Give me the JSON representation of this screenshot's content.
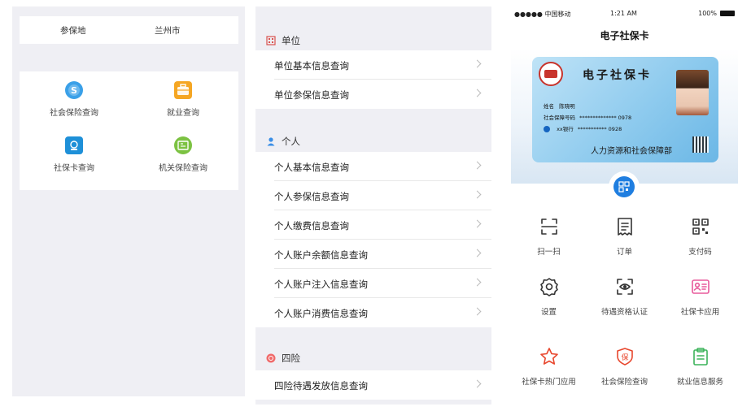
{
  "left_panel": {
    "location_label": "参保地",
    "location_value": "兰州市",
    "items": [
      {
        "label": "社会保险查询",
        "icon": "social-insurance-icon",
        "color": "#3aa0e8"
      },
      {
        "label": "就业查询",
        "icon": "briefcase-icon",
        "color": "#f5a623"
      },
      {
        "label": "社保卡查询",
        "icon": "card-icon",
        "color": "#1e90d8"
      },
      {
        "label": "机关保险查询",
        "icon": "id-card-icon",
        "color": "#7cc242"
      }
    ]
  },
  "middle_panel": {
    "sections": [
      {
        "title": "单位",
        "icon": "building-icon",
        "color": "#d9534f",
        "items": [
          "单位基本信息查询",
          "单位参保信息查询"
        ]
      },
      {
        "title": "个人",
        "icon": "person-icon",
        "color": "#3a8ee6",
        "items": [
          "个人基本信息查询",
          "个人参保信息查询",
          "个人缴费信息查询",
          "个人账户余额信息查询",
          "个人账户注入信息查询",
          "个人账户消费信息查询"
        ]
      },
      {
        "title": "四险",
        "icon": "four-insurance-icon",
        "color": "#f06a6a",
        "items": [
          "四险待遇发放信息查询"
        ]
      }
    ]
  },
  "right_panel": {
    "status": {
      "carrier": "●●●●● 中国移动",
      "time": "1:21 AM",
      "battery": "100%"
    },
    "title": "电子社保卡",
    "card": {
      "title": "电子社保卡",
      "name_label": "姓名",
      "name": "陈晓明",
      "number_label": "社会保障号码",
      "number": "************** 0978",
      "bank_label": "xx银行",
      "bank_number": "*********** 0928",
      "issuer": "人力资源和社会保障部"
    },
    "actions": [
      {
        "label": "扫一扫",
        "icon": "scan-icon",
        "color": "#333333"
      },
      {
        "label": "订单",
        "icon": "receipt-icon",
        "color": "#333333"
      },
      {
        "label": "支付码",
        "icon": "qr-code-icon",
        "color": "#333333"
      },
      {
        "label": "设置",
        "icon": "settings-icon",
        "color": "#333333"
      },
      {
        "label": "待遇资格认证",
        "icon": "face-verify-icon",
        "color": "#333333"
      },
      {
        "label": "社保卡应用",
        "icon": "card-app-icon",
        "color": "#e85a9c"
      },
      {
        "label": "社保卡热门应用",
        "icon": "star-icon",
        "color": "#e8472e"
      },
      {
        "label": "社会保险查询",
        "icon": "shield-bao-icon",
        "color": "#e8472e"
      },
      {
        "label": "就业信息服务",
        "icon": "clipboard-icon",
        "color": "#3bb35a"
      }
    ]
  }
}
